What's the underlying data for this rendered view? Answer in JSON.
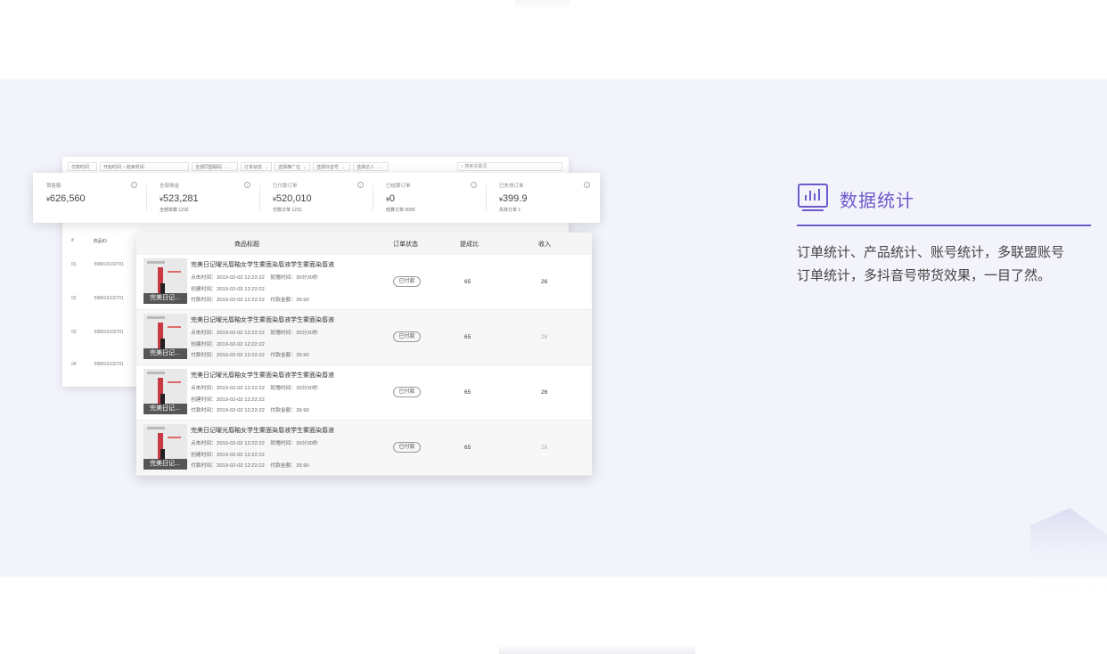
{
  "filters": [
    {
      "label": "付款时间"
    },
    {
      "label": "开始时间 ~ 结束时间"
    },
    {
      "label": "全部同盟联码"
    },
    {
      "label": "订单状态"
    },
    {
      "label": "选择推广位"
    },
    {
      "label": "选择抖音号"
    },
    {
      "label": "选择达人"
    }
  ],
  "search_placeholder": "搜索关键词",
  "stats": [
    {
      "label": "销售额",
      "value": "626,560",
      "sub": ""
    },
    {
      "label": "全部佣金",
      "value": "523,281",
      "sub": "全部单数 1232"
    },
    {
      "label": "已付款订单",
      "value": "520,010",
      "sub": "付款订单 1231"
    },
    {
      "label": "已结算订单",
      "value": "0",
      "sub": "结算订单 0000"
    },
    {
      "label": "已失效订单",
      "value": "399.9",
      "sub": "失效订单 1"
    }
  ],
  "currency": "¥",
  "left_table": {
    "headers": [
      "#",
      "商品ID"
    ],
    "rows": [
      [
        "01",
        "598015102701"
      ],
      [
        "02",
        "598015102701"
      ],
      [
        "03",
        "598015102701"
      ],
      [
        "04",
        "598015102701"
      ]
    ]
  },
  "order_table": {
    "headers": {
      "title": "商品标题",
      "status": "订单状态",
      "ratio": "提成比",
      "income": "收入"
    },
    "rows": [
      {
        "title": "完美日记曜光唇釉女学生雾面染唇液学生雾面染唇液",
        "click_time": "点击时间：2019-02-02 12:22:22",
        "stay": "就撸时间：30分30秒",
        "create_time": "创建时间：2019-02-02 12:22:22",
        "pay_time": "付款时间：2019-02-02 12:22:22",
        "pay_amount": "付款金额：39.90",
        "thumb_caption": "完美日记...",
        "status": "已付款",
        "ratio": "65",
        "income": "26"
      },
      {
        "title": "完美日记曜光唇釉女学生雾面染唇液学生雾面染唇液",
        "click_time": "点击时间：2019-02-02 12:22:22",
        "stay": "就撸时间：30分30秒",
        "create_time": "创建时间：2019-02-02 12:22:22",
        "pay_time": "付款时间：2019-02-02 12:22:22",
        "pay_amount": "付款金额：39.90",
        "thumb_caption": "完美日记...",
        "status": "已付款",
        "ratio": "65",
        "income": "26"
      },
      {
        "title": "完美日记曜光唇釉女学生雾面染唇液学生雾面染唇液",
        "click_time": "点击时间：2019-02-02 12:22:22",
        "stay": "就撸时间：30分30秒",
        "create_time": "创建时间：2019-02-02 12:22:22",
        "pay_time": "付款时间：2019-02-02 12:22:22",
        "pay_amount": "付款金额：39.90",
        "thumb_caption": "完美日记...",
        "status": "已付款",
        "ratio": "65",
        "income": "26"
      },
      {
        "title": "完美日记曜光唇釉女学生雾面染唇液学生雾面染唇液",
        "click_time": "点击时间：2019-02-02 12:22:22",
        "stay": "就撸时间：30分30秒",
        "create_time": "创建时间：2019-02-02 12:22:22",
        "pay_time": "付款时间：2019-02-02 12:22:22",
        "pay_amount": "付款金额：39.90",
        "thumb_caption": "完美日记...",
        "status": "已付款",
        "ratio": "65",
        "income": "26"
      }
    ]
  },
  "feature": {
    "icon": "bar-chart-icon",
    "title": "数据统计",
    "desc_line1": "订单统计、产品统计、账号统计，多联盟账号",
    "desc_line2": "订单统计，多抖音号带货效果，一目了然。",
    "accent": "#6b5bcb"
  }
}
